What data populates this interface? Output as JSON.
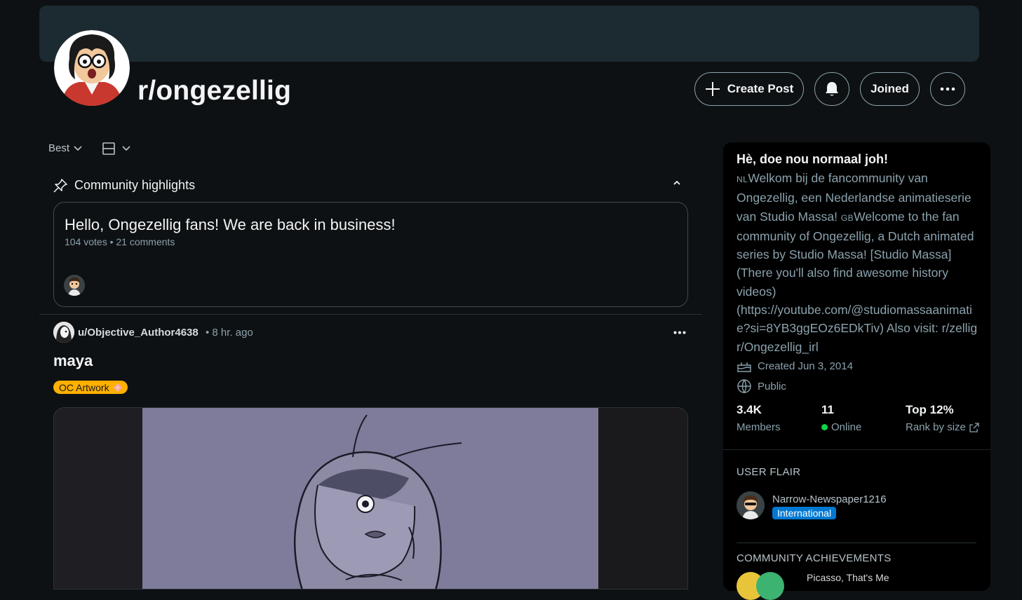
{
  "header": {
    "subreddit": "r/ongezellig",
    "create_post": "Create Post",
    "joined": "Joined"
  },
  "feed": {
    "sort": "Best"
  },
  "highlights": {
    "label": "Community highlights",
    "card": {
      "title": "Hello, Ongezellig fans! We are back in business!",
      "meta": "104 votes • 21 comments"
    }
  },
  "post": {
    "author": "u/Objective_Author4638",
    "time": "• 8 hr. ago",
    "title": "maya",
    "flair": "OC Artwork"
  },
  "sidebar": {
    "title": "Hè, doe nou normaal joh!",
    "desc": {
      "nl_flag": "NL",
      "part1": "Welkom bij de fancommunity van Ongezellig, een Nederlandse animatieserie van Studio Massa! ",
      "gb_flag": "GB",
      "part2": "Welcome to the fan community of Ongezellig, a Dutch animated series by Studio Massa! [Studio Massa] (There you'll also find awesome history videos) (https://youtube.com/@studiomassaanimatie?si=8YB3ggEOz6EDkTiv) Also visit: r/zellig r/Ongezellig_irl"
    },
    "created": "Created Jun 3, 2014",
    "visibility": "Public",
    "stats": {
      "members_value": "3.4K",
      "members_label": "Members",
      "online_value": "11",
      "online_label": "Online",
      "rank_value": "Top 12%",
      "rank_label": "Rank by size"
    },
    "user_flair": {
      "heading": "USER FLAIR",
      "username": "Narrow-Newspaper1216",
      "badge": "International"
    },
    "achievements": {
      "heading": "COMMUNITY ACHIEVEMENTS",
      "first": "Picasso, That's Me"
    }
  },
  "colors": {
    "background": "#0e1113",
    "banner": "#1c2a31",
    "flair_oc": "#ffb000",
    "flair_international": "#0079d3",
    "online_dot": "#0bd34a"
  }
}
